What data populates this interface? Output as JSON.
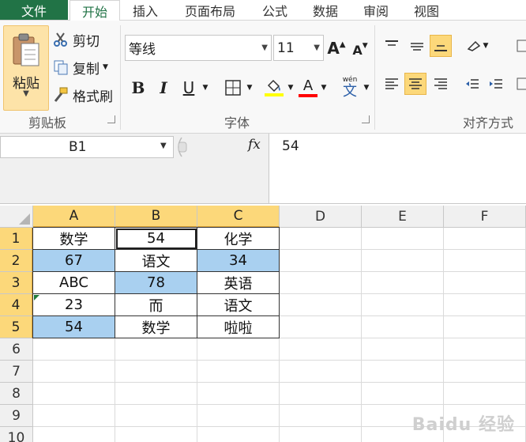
{
  "menu": {
    "file": "文件",
    "tabs": [
      "开始",
      "插入",
      "页面布局",
      "公式",
      "数据",
      "审阅",
      "视图"
    ]
  },
  "ribbon": {
    "clipboard": {
      "paste": "粘贴",
      "cut": "剪切",
      "copy": "复制",
      "format_painter": "格式刷",
      "group_label": "剪贴板"
    },
    "font": {
      "name": "等线",
      "size": "11",
      "bold": "B",
      "italic": "I",
      "underline": "U",
      "wen": "wén",
      "wen_char": "文",
      "font_color_letter": "A",
      "grow": "A",
      "shrink": "A",
      "group_label": "字体",
      "highlight_color": "#ffff00",
      "font_color": "#ff0000"
    },
    "alignment": {
      "group_label": "对齐方式"
    }
  },
  "formula_bar": {
    "name_box": "B1",
    "fx": "fx",
    "content": "54"
  },
  "sheet": {
    "columns": [
      "A",
      "B",
      "C",
      "D",
      "E",
      "F"
    ],
    "rows": [
      "1",
      "2",
      "3",
      "4",
      "5",
      "6",
      "7",
      "8",
      "9",
      "10"
    ],
    "cells": [
      [
        "数学",
        "54",
        "化学"
      ],
      [
        "67",
        "语文",
        "34"
      ],
      [
        "ABC",
        "78",
        "英语"
      ],
      [
        "23",
        "而",
        "语文"
      ],
      [
        "54",
        "数学",
        "啦啦"
      ]
    ],
    "highlight_color": "#a9d0f0",
    "selected_cell": "B1"
  },
  "watermark": "Baidu 经验"
}
